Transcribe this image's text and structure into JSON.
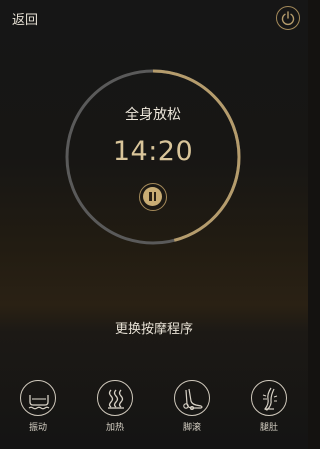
{
  "header": {
    "back_label": "返回",
    "power_icon": "power-icon"
  },
  "session": {
    "program_name": "全身放松",
    "remaining_time": "14:20",
    "progress_fraction": 0.46,
    "state_icon": "pause-icon"
  },
  "actions": {
    "change_program_label": "更换按摩程序"
  },
  "functions": [
    {
      "label": "振动",
      "icon": "vibration-icon"
    },
    {
      "label": "加热",
      "icon": "heating-icon"
    },
    {
      "label": "脚滚",
      "icon": "foot-roller-icon"
    },
    {
      "label": "腿肚",
      "icon": "calf-icon"
    }
  ],
  "colors": {
    "accent_gold": "#c9ad74",
    "ring_track": "#5a5a5a",
    "ring_progress": "#b59c6c"
  }
}
